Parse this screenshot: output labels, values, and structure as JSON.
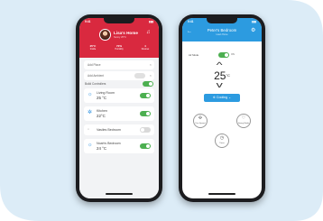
{
  "left_phone": {
    "status_time": "9:41",
    "status_battery": "▮▮▮",
    "title": "Lisa's Home",
    "subtitle": "Sunny 25°C",
    "stats": [
      {
        "value": "25°C",
        "label": "Inside"
      },
      {
        "value": "72%",
        "label": "Humidity"
      },
      {
        "value": "4",
        "label": "Devices"
      }
    ],
    "add_buttons": [
      "Add Place",
      "Add Ambient"
    ],
    "list_heading": "Build Controllers",
    "rooms": [
      {
        "name": "Living Room",
        "temp": "25 °C",
        "icon": "☼",
        "on": true
      },
      {
        "name": "Kitchen",
        "temp": "22°C",
        "icon": "✲",
        "on": true
      },
      {
        "name": "Vasiles Bedroom",
        "temp": "",
        "icon": "◦",
        "on": false
      },
      {
        "name": "Noah's Bedroom",
        "temp": "24 °C",
        "icon": "☼",
        "on": true
      }
    ]
  },
  "right_phone": {
    "status_time": "9:41",
    "status_battery": "▮▮▮",
    "title": "Peter's Bedroom",
    "subtitle": "Lisa's Home",
    "power_label": "Air Mode",
    "power_state": "ON",
    "setpoint_value": "25",
    "setpoint_unit": "°C",
    "mode_label": "Cooling",
    "quick_actions": [
      {
        "label": "Fan Speed",
        "icon": "fan-icon"
      },
      {
        "label": "Swing Mode",
        "icon": "swing-icon"
      },
      {
        "label": "Timer",
        "icon": "timer-icon"
      }
    ]
  },
  "colors": {
    "background_panel": "#dcecf7",
    "left_accent": "#d9293f",
    "right_accent": "#2c9be0",
    "toggle_on": "#4caf50"
  }
}
